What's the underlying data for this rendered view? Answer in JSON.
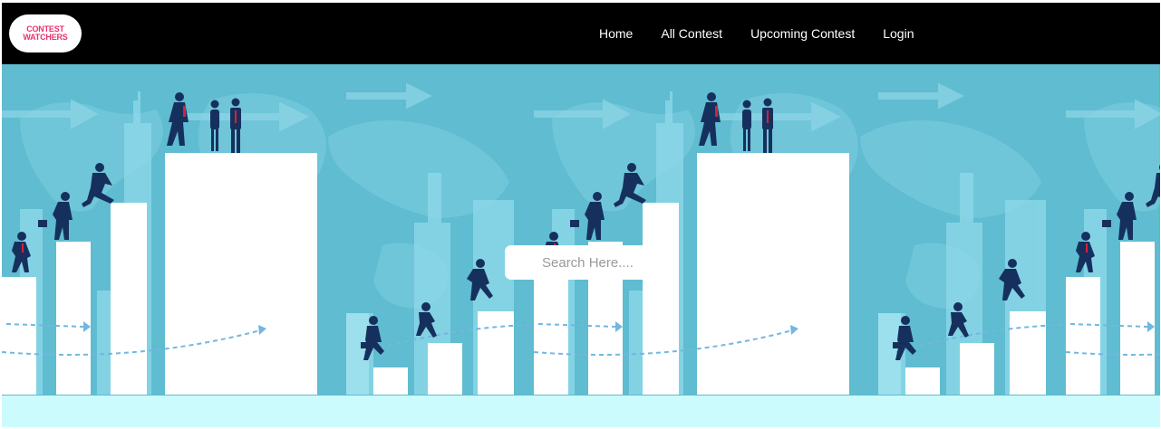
{
  "brand": {
    "line1": "CONTEST",
    "line2": "WATCHERS",
    "color": "#e8336b"
  },
  "nav": {
    "items": [
      {
        "label": "Home"
      },
      {
        "label": "All Contest"
      },
      {
        "label": "Upcoming Contest"
      },
      {
        "label": "Login"
      }
    ]
  },
  "search": {
    "placeholder": "Search Here...."
  },
  "colors": {
    "navbar": "#000000",
    "hero_bg": "#5fbcd1",
    "figure": "#16305e",
    "ground": "#ccfbfd"
  }
}
